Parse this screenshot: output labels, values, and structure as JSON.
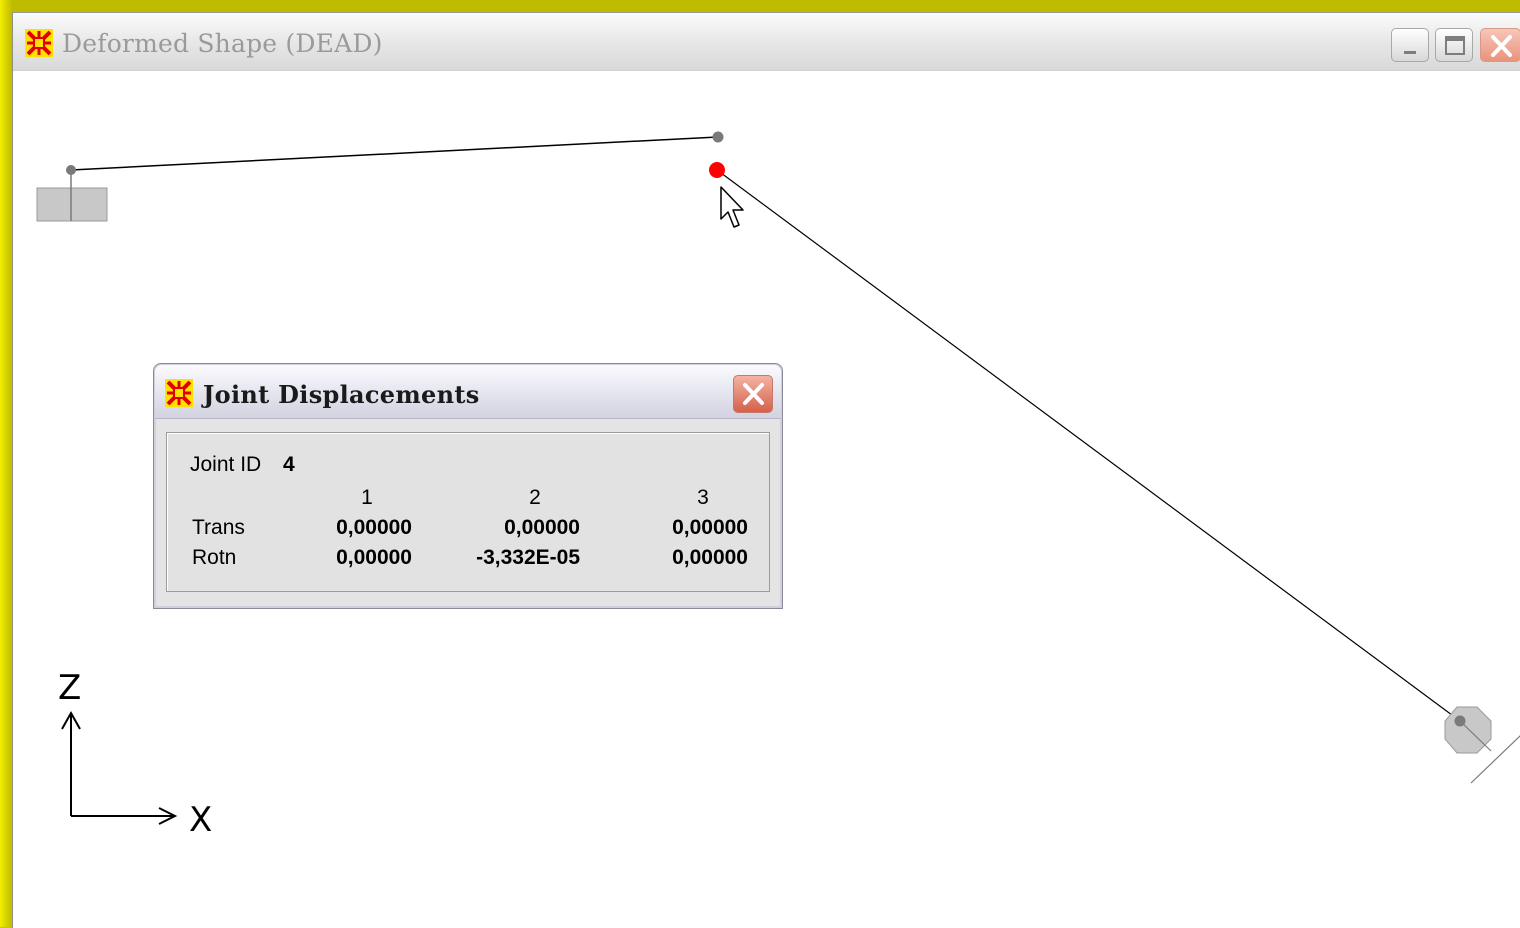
{
  "window": {
    "title": "Deformed Shape (DEAD)",
    "icon": "sap-app-icon"
  },
  "dialog": {
    "title": "Joint Displacements",
    "joint_id_label": "Joint ID",
    "joint_id_value": "4",
    "columns": [
      "1",
      "2",
      "3"
    ],
    "rows": [
      {
        "label": "Trans",
        "values": [
          "0,00000",
          "0,00000",
          "0,00000"
        ]
      },
      {
        "label": "Rotn",
        "values": [
          "0,00000",
          "-3,332E-05",
          "0,00000"
        ]
      }
    ]
  },
  "axes": {
    "vertical": "Z",
    "horizontal": "X"
  },
  "colors": {
    "selected_joint": "#ff0000",
    "joint": "#7a7a7a",
    "support_fill": "#c8c8c8",
    "frame_border": "#c8c800"
  }
}
